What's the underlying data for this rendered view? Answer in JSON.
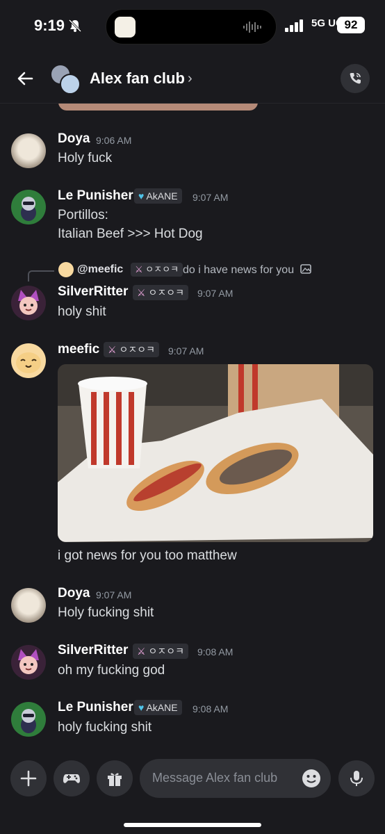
{
  "status": {
    "time": "9:19",
    "network": "5G UC",
    "battery": "92"
  },
  "header": {
    "title": "Alex fan club",
    "chevron": "›"
  },
  "messages": [
    {
      "author": "Doya",
      "time": "9:06 AM",
      "lines": [
        "Holy fuck"
      ]
    },
    {
      "author": "Le Punisher",
      "tag": "AkANE",
      "time": "9:07 AM",
      "lines": [
        "Portillos:",
        "Italian Beef >>> Hot Dog"
      ]
    },
    {
      "author": "SilverRitter",
      "tag": "ㅇㅈㅇㅋ",
      "time": "9:07 AM",
      "lines": [
        "holy shit"
      ],
      "reply": {
        "author": "@meefic",
        "tag": "ㅇㅈㅇㅋ",
        "text": "do i have news for you"
      }
    },
    {
      "author": "meefic",
      "tag": "ㅇㅈㅇㅋ",
      "time": "9:07 AM",
      "lines": [
        "i got news for you too matthew"
      ]
    },
    {
      "author": "Doya",
      "time": "9:07 AM",
      "lines": [
        "Holy fucking shit"
      ]
    },
    {
      "author": "SilverRitter",
      "tag": "ㅇㅈㅇㅋ",
      "time": "9:08 AM",
      "lines": [
        "oh my fucking god"
      ]
    },
    {
      "author": "Le Punisher",
      "tag": "AkANE",
      "time": "9:08 AM",
      "lines": [
        "holy fucking shit"
      ]
    }
  ],
  "composer": {
    "placeholder": "Message Alex fan club"
  }
}
